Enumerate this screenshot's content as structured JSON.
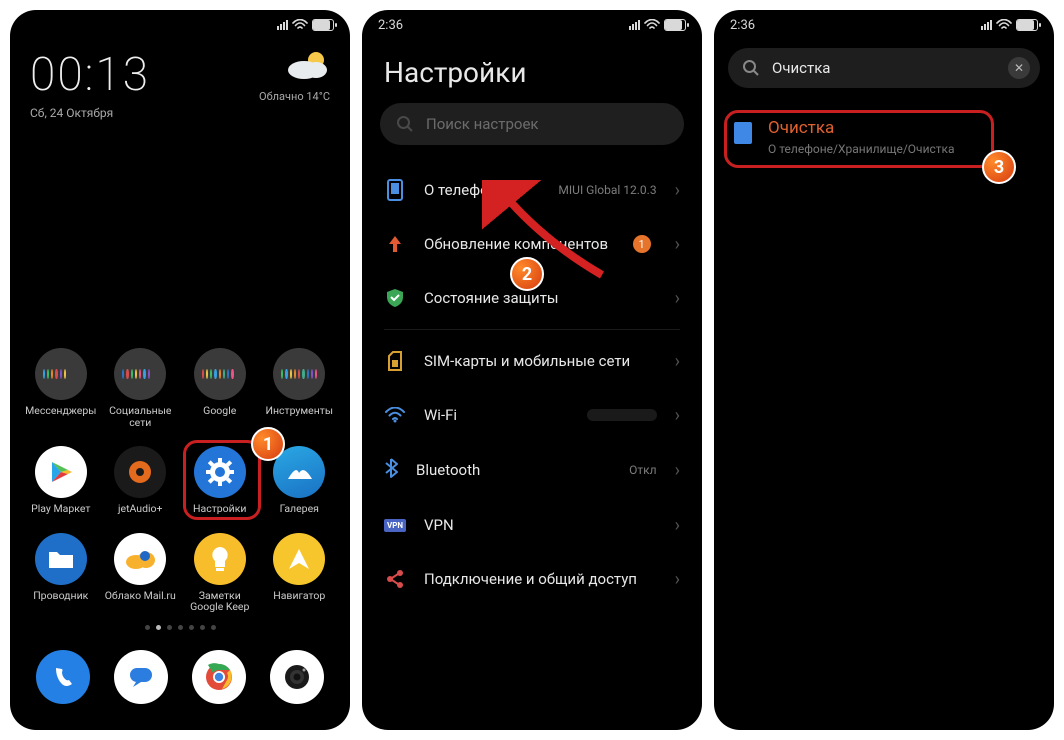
{
  "phone1": {
    "clock": {
      "time": "00:13",
      "date": "Сб, 24 Октября"
    },
    "weather": {
      "text": "Облачно  14°C"
    },
    "apps": [
      {
        "label": "Мессенджеры",
        "kind": "folder"
      },
      {
        "label": "Социальные сети",
        "kind": "folder"
      },
      {
        "label": "Google",
        "kind": "folder"
      },
      {
        "label": "Инструменты",
        "kind": "folder"
      },
      {
        "label": "Play Маркет",
        "kind": "play"
      },
      {
        "label": "jetAudio+",
        "kind": "jetaudio"
      },
      {
        "label": "Настройки",
        "kind": "settings"
      },
      {
        "label": "Галерея",
        "kind": "gallery"
      },
      {
        "label": "Проводник",
        "kind": "files"
      },
      {
        "label": "Облако Mail.ru",
        "kind": "cloud"
      },
      {
        "label": "Заметки Google Keep",
        "kind": "keep"
      },
      {
        "label": "Навигатор",
        "kind": "nav"
      }
    ],
    "step_badge": "1"
  },
  "phone2": {
    "time": "2:36",
    "title": "Настройки",
    "search_placeholder": "Поиск настроек",
    "rows": [
      {
        "icon": "about",
        "label": "О телефоне",
        "meta": "MIUI Global 12.0.3"
      },
      {
        "icon": "upd",
        "label": "Обновление компонентов",
        "badge": "1"
      },
      {
        "icon": "security",
        "label": "Состояние защиты"
      },
      {
        "icon": "sim",
        "label": "SIM-карты и мобильные сети"
      },
      {
        "icon": "wifi",
        "label": "Wi-Fi",
        "meta": ""
      },
      {
        "icon": "bt",
        "label": "Bluetooth",
        "meta": "Откл"
      },
      {
        "icon": "vpn",
        "label": "VPN"
      },
      {
        "icon": "share",
        "label": "Подключение и общий доступ"
      }
    ],
    "step_badge": "2"
  },
  "phone3": {
    "time": "2:36",
    "search_value": "Очистка",
    "result": {
      "title": "Очистка",
      "path": "О телефоне/Хранилище/Очистка"
    },
    "step_badge": "3"
  }
}
